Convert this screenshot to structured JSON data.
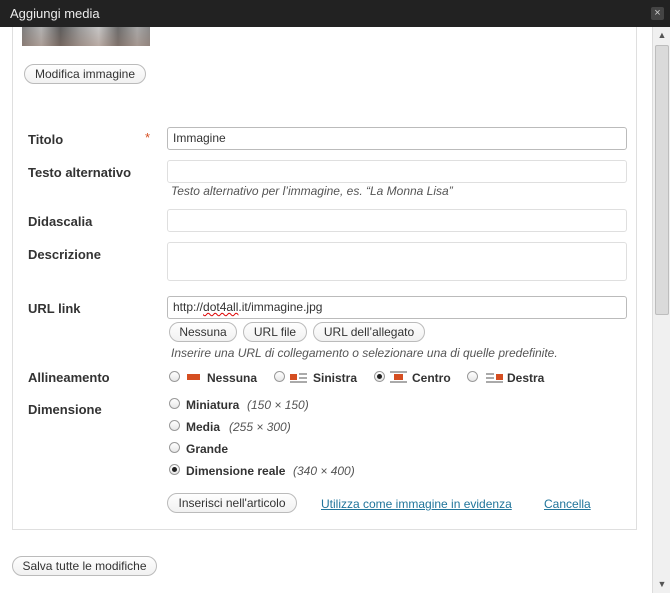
{
  "window": {
    "title": "Aggiungi media",
    "close_icon": "×"
  },
  "buttons": {
    "edit_image": "Modifica immagine",
    "save_all": "Salva tutte le modifiche"
  },
  "fields": {
    "title": {
      "label": "Titolo",
      "required_mark": "*",
      "value": "Immagine"
    },
    "alt": {
      "label": "Testo alternativo",
      "value": "",
      "help": "Testo alternativo per l’immagine, es. “La Monna Lisa”"
    },
    "caption": {
      "label": "Didascalia",
      "value": ""
    },
    "description": {
      "label": "Descrizione",
      "value": ""
    },
    "url": {
      "label": "URL link",
      "value_prefix": "http://",
      "value_spell": "dot4all",
      "value_suffix": ".it/immagine.jpg",
      "help": "Inserire una URL di collegamento o selezionare una di quelle predefinite.",
      "buttons": {
        "none": "Nessuna",
        "file": "URL file",
        "post": "URL dell’allegato"
      }
    }
  },
  "alignment": {
    "label": "Allineamento",
    "options": [
      "Nessuna",
      "Sinistra",
      "Centro",
      "Destra"
    ],
    "selected": "Centro"
  },
  "size": {
    "label": "Dimensione",
    "options": [
      {
        "name": "Miniatura",
        "dims": "(150 × 150)"
      },
      {
        "name": "Media",
        "dims": "(255 × 300)"
      },
      {
        "name": "Grande",
        "dims": ""
      },
      {
        "name": "Dimensione reale",
        "dims": "(340 × 400)"
      }
    ],
    "selected": "Dimensione reale"
  },
  "actions": {
    "insert": "Inserisci nell'articolo",
    "featured": "Utilizza come immagine in evidenza",
    "cancel": "Cancella"
  },
  "colors": {
    "accent": "#21759b",
    "required": "#d54e21",
    "titlebar": "#222222"
  }
}
